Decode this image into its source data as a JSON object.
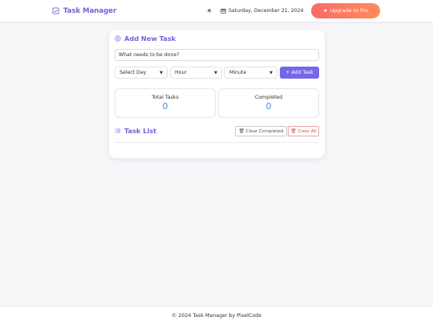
{
  "header": {
    "brand": "Task Manager",
    "theme_icon": "sun-icon",
    "date": "Saturday, December 21, 2024",
    "upgrade_label": "Upgrade to Pro"
  },
  "add_task": {
    "title": "Add New Task",
    "input_placeholder": "What needs to be done?",
    "day_select": "Select Day",
    "hour_select": "Hour",
    "minute_select": "Minute",
    "add_button": "+ Add Task"
  },
  "stats": {
    "total_label": "Total Tasks",
    "total_value": "0",
    "completed_label": "Completed",
    "completed_value": "0"
  },
  "task_list": {
    "title": "Task List",
    "clear_completed": "Clear Completed",
    "clear_all": "Clear All"
  },
  "footer": {
    "text": "© 2024 Task Manager by PixelCode"
  },
  "colors": {
    "accent": "#6f63d9",
    "button": "#7568e8",
    "upgrade_start": "#fb6a68",
    "upgrade_end": "#ff8c5a",
    "stat_value": "#4a90e2",
    "danger": "#d9534f"
  }
}
